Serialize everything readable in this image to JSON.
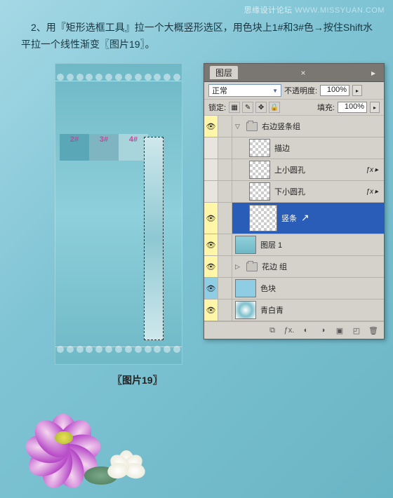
{
  "watermark": {
    "main": "思缘设计论坛",
    "url": "WWW.MISSYUAN.COM"
  },
  "instruction": "　2、用『矩形选框工具』拉一个大概竖形选区，用色块上1#和3#色→按住Shift水平拉一个线性渐变〖图片19〗。",
  "swatches": {
    "s2": "2#",
    "s3": "3#",
    "s4": "4#"
  },
  "figure_caption": "〖图片19〗",
  "panel": {
    "title": "图层",
    "blend_mode": "正常",
    "opacity_label": "不透明度:",
    "opacity_value": "100%",
    "lock_label": "锁定:",
    "fill_label": "填充:",
    "fill_value": "100%",
    "layers": [
      {
        "name": "右边竖条组",
        "type": "group",
        "vis": true
      },
      {
        "name": "描边",
        "type": "layer",
        "vis": false
      },
      {
        "name": "上小圆孔",
        "type": "layer",
        "vis": false,
        "fx": true
      },
      {
        "name": "下小圆孔",
        "type": "layer",
        "vis": false,
        "fx": true
      },
      {
        "name": "竖条",
        "type": "layer",
        "vis": true,
        "selected": true
      },
      {
        "name": "图层 1",
        "type": "layer",
        "vis": true
      },
      {
        "name": "花边 组",
        "type": "group",
        "vis": true
      },
      {
        "name": "色块",
        "type": "layer",
        "vis": true,
        "thumb": "blue"
      },
      {
        "name": "青白青",
        "type": "layer",
        "vis": true,
        "thumb": "radial"
      }
    ],
    "footer_icons": [
      "link",
      "fx",
      "mask",
      "adjust",
      "folder",
      "new",
      "trash"
    ]
  }
}
